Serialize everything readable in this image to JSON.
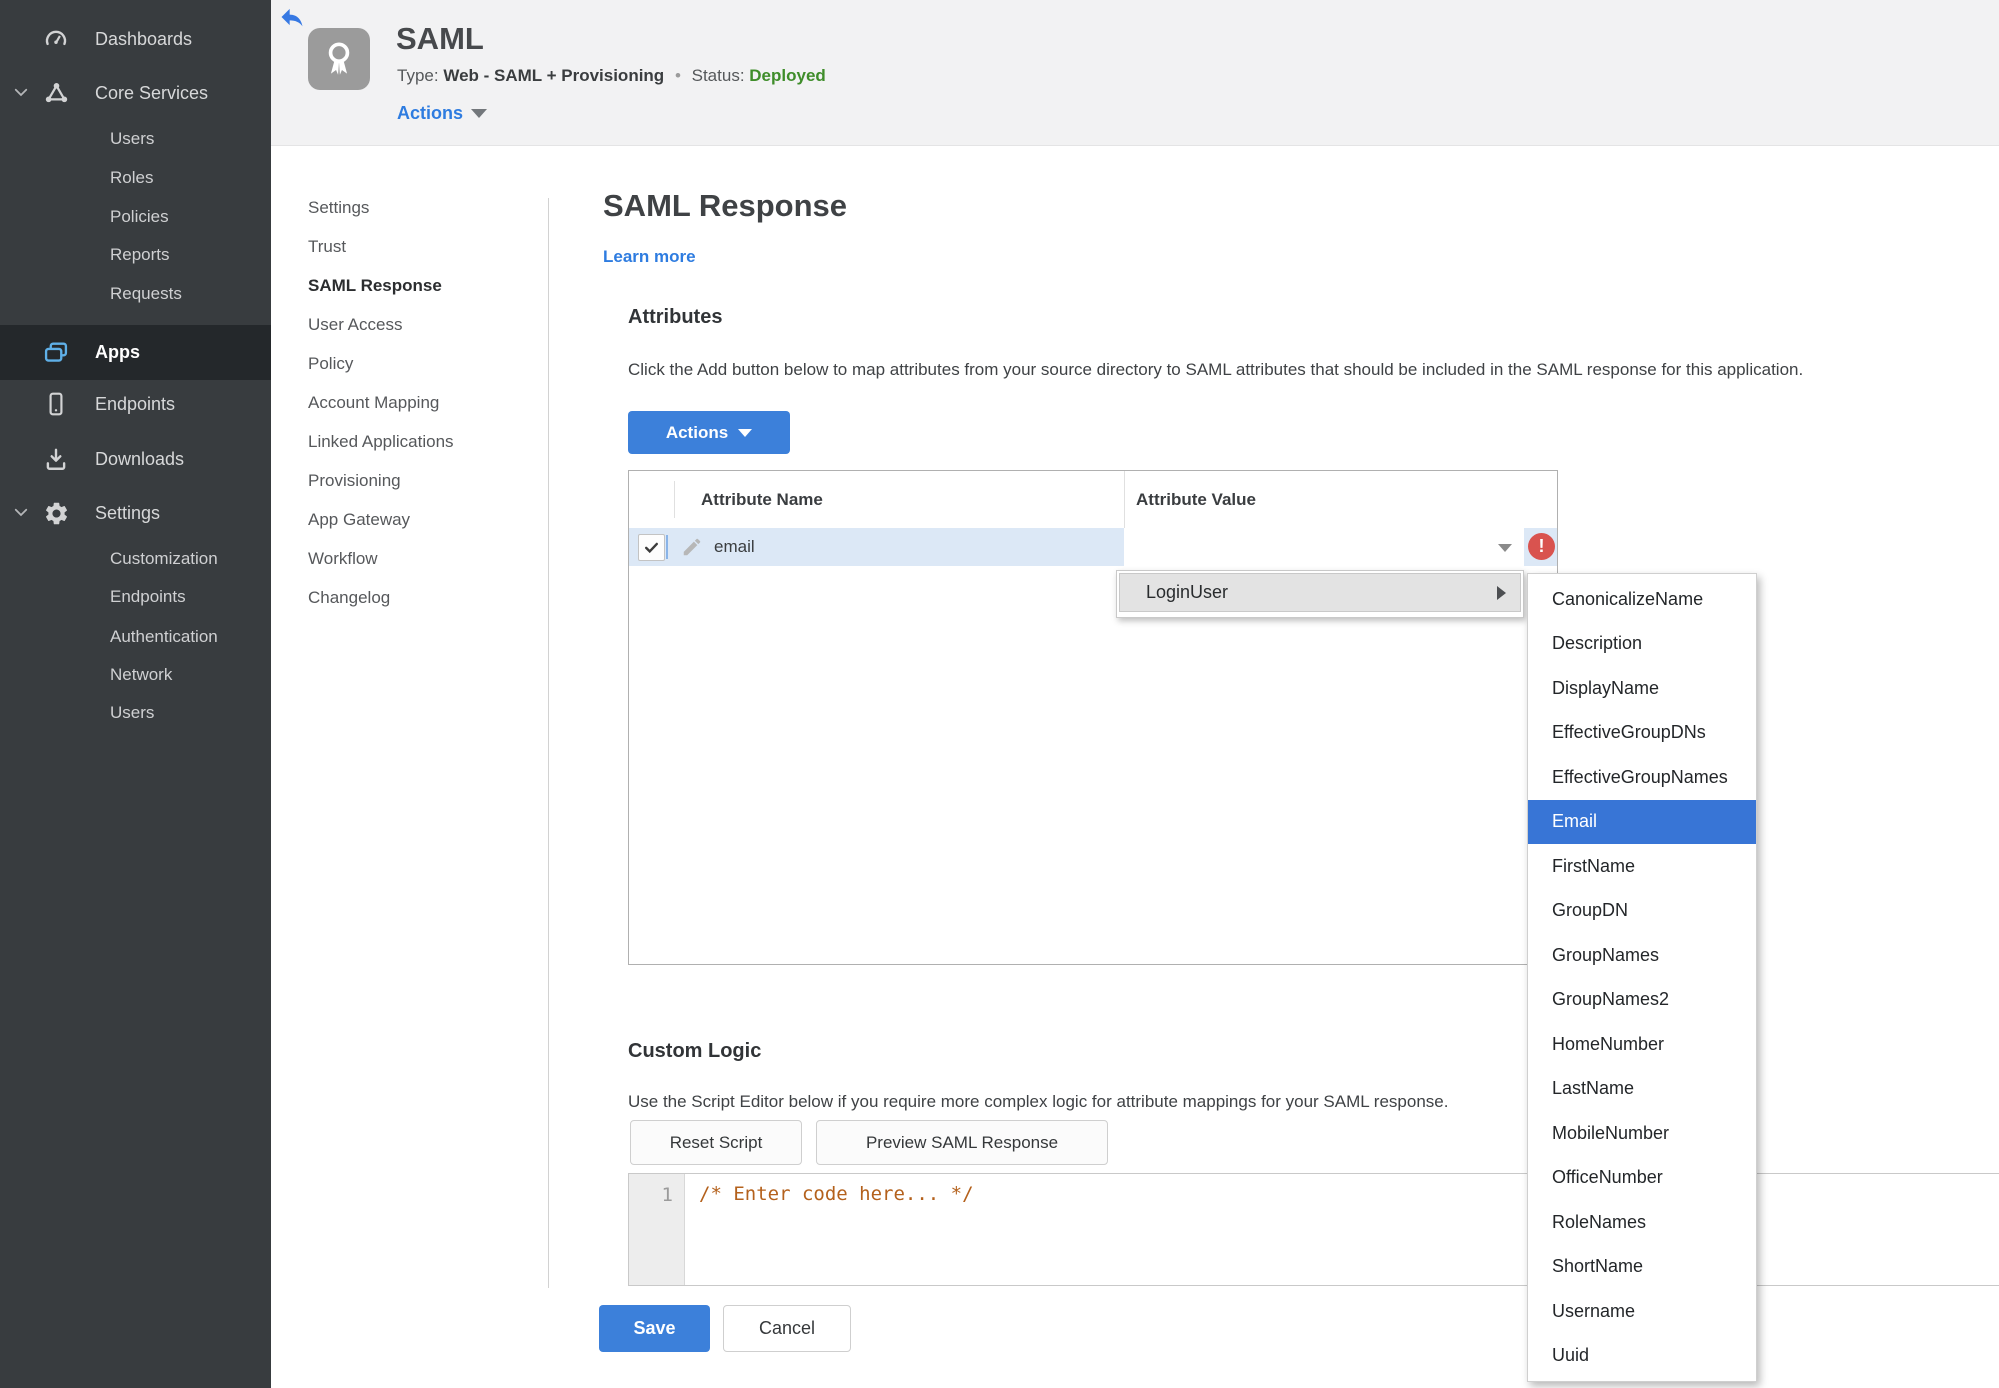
{
  "colors": {
    "accent_blue": "#3c80da",
    "link_blue": "#2e7ce0",
    "selection_blue": "#3875d6",
    "status_green": "#3f8d2a",
    "error_red": "#d9534f",
    "row_highlight": "#dce8f6",
    "sidebar_bg": "#383c3f",
    "sidebar_active_bg": "#24282b",
    "header_bg": "#f2f2f3",
    "code_comment": "#b4611c"
  },
  "sidebar": {
    "items": [
      {
        "label": "Dashboards",
        "icon": "gauge"
      },
      {
        "label": "Core Services",
        "icon": "hub",
        "expanded": true
      },
      {
        "label": "Users"
      },
      {
        "label": "Roles"
      },
      {
        "label": "Policies"
      },
      {
        "label": "Reports"
      },
      {
        "label": "Requests"
      },
      {
        "label": "Apps",
        "icon": "apps",
        "active": true
      },
      {
        "label": "Endpoints",
        "icon": "phone"
      },
      {
        "label": "Downloads",
        "icon": "download"
      },
      {
        "label": "Settings",
        "icon": "gear",
        "expanded": true
      },
      {
        "label": "Customization"
      },
      {
        "label": "Endpoints"
      },
      {
        "label": "Authentication"
      },
      {
        "label": "Network"
      },
      {
        "label": "Users"
      }
    ]
  },
  "header": {
    "title": "SAML",
    "type_label": "Type:",
    "type_value": "Web - SAML + Provisioning",
    "separator": "•",
    "status_label": "Status:",
    "status_value": "Deployed",
    "actions_label": "Actions"
  },
  "subnav": {
    "items": [
      {
        "label": "Settings"
      },
      {
        "label": "Trust"
      },
      {
        "label": "SAML Response",
        "active": true
      },
      {
        "label": "User Access"
      },
      {
        "label": "Policy"
      },
      {
        "label": "Account Mapping"
      },
      {
        "label": "Linked Applications"
      },
      {
        "label": "Provisioning"
      },
      {
        "label": "App Gateway"
      },
      {
        "label": "Workflow"
      },
      {
        "label": "Changelog"
      }
    ]
  },
  "main": {
    "title": "SAML Response",
    "learn_more": "Learn more",
    "attributes": {
      "heading": "Attributes",
      "description": "Click the Add button below to map attributes from your source directory to SAML attributes that should be included in the SAML response for this application.",
      "actions_button": "Actions",
      "table": {
        "col_name": "Attribute Name",
        "col_value": "Attribute Value",
        "row": {
          "name": "email",
          "checked": true,
          "value": "",
          "error": true
        }
      }
    },
    "custom_logic": {
      "heading": "Custom Logic",
      "description": "Use the Script Editor below if you require more complex logic for attribute mappings for your SAML response.",
      "reset_button": "Reset Script",
      "preview_button": "Preview SAML Response",
      "editor": {
        "line_number": "1",
        "code": "/* Enter code here... */"
      }
    },
    "save_button": "Save",
    "cancel_button": "Cancel"
  },
  "menu": {
    "trigger": "LoginUser",
    "selected": "Email",
    "items": [
      "CanonicalizeName",
      "Description",
      "DisplayName",
      "EffectiveGroupDNs",
      "EffectiveGroupNames",
      "Email",
      "FirstName",
      "GroupDN",
      "GroupNames",
      "GroupNames2",
      "HomeNumber",
      "LastName",
      "MobileNumber",
      "OfficeNumber",
      "RoleNames",
      "ShortName",
      "Username",
      "Uuid"
    ]
  }
}
